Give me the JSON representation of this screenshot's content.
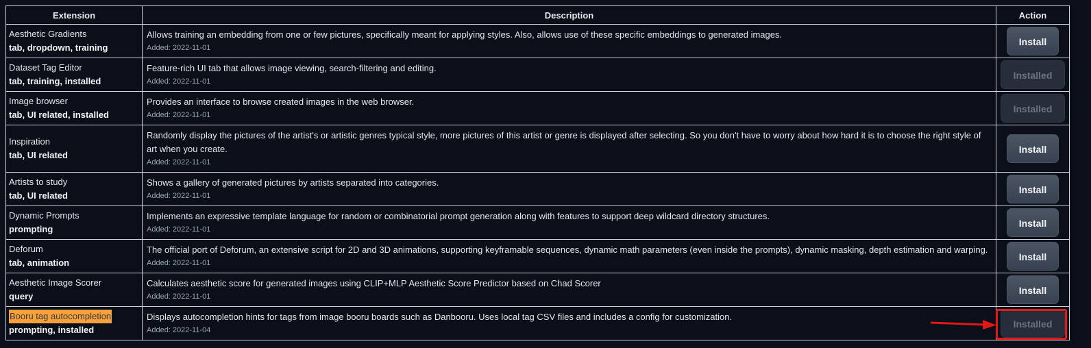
{
  "table": {
    "headers": [
      "Extension",
      "Description",
      "Action"
    ],
    "rows": [
      {
        "name": "Aesthetic Gradients",
        "tags": "tab, dropdown, training",
        "description": "Allows training an embedding from one or few pictures, specifically meant for applying styles. Also, allows use of these specific embeddings to generated images.",
        "added": "Added: 2022-11-01",
        "action": "Install",
        "installed": false
      },
      {
        "name": "Dataset Tag Editor",
        "tags": "tab, training, installed",
        "description": "Feature-rich UI tab that allows image viewing, search-filtering and editing.",
        "added": "Added: 2022-11-01",
        "action": "Installed",
        "installed": true
      },
      {
        "name": "Image browser",
        "tags": "tab, UI related, installed",
        "description": "Provides an interface to browse created images in the web browser.",
        "added": "Added: 2022-11-01",
        "action": "Installed",
        "installed": true
      },
      {
        "name": "Inspiration",
        "tags": "tab, UI related",
        "description": "Randomly display the pictures of the artist's or artistic genres typical style, more pictures of this artist or genre is displayed after selecting. So you don't have to worry about how hard it is to choose the right style of art when you create.",
        "added": "Added: 2022-11-01",
        "action": "Install",
        "installed": false
      },
      {
        "name": "Artists to study",
        "tags": "tab, UI related",
        "description": "Shows a gallery of generated pictures by artists separated into categories.",
        "added": "Added: 2022-11-01",
        "action": "Install",
        "installed": false
      },
      {
        "name": "Dynamic Prompts",
        "tags": "prompting",
        "description": "Implements an expressive template language for random or combinatorial prompt generation along with features to support deep wildcard directory structures.",
        "added": "Added: 2022-11-01",
        "action": "Install",
        "installed": false
      },
      {
        "name": "Deforum",
        "tags": "tab, animation",
        "description": "The official port of Deforum, an extensive script for 2D and 3D animations, supporting keyframable sequences, dynamic math parameters (even inside the prompts), dynamic masking, depth estimation and warping.",
        "added": "Added: 2022-11-01",
        "action": "Install",
        "installed": false
      },
      {
        "name": "Aesthetic Image Scorer",
        "tags": "query",
        "description": "Calculates aesthetic score for generated images using CLIP+MLP Aesthetic Score Predictor based on Chad Scorer",
        "added": "Added: 2022-11-01",
        "action": "Install",
        "installed": false
      },
      {
        "name": "Booru tag autocompletion",
        "tags": "prompting, installed",
        "description": "Displays autocompletion hints for tags from image booru boards such as Danbooru. Uses local tag CSV files and includes a config for customization.",
        "added": "Added: 2022-11-04",
        "action": "Installed",
        "installed": true,
        "highlighted": true
      }
    ]
  },
  "colors": {
    "background": "#0b0f19",
    "highlight": "#f7a13c",
    "annotation": "#e01818"
  }
}
